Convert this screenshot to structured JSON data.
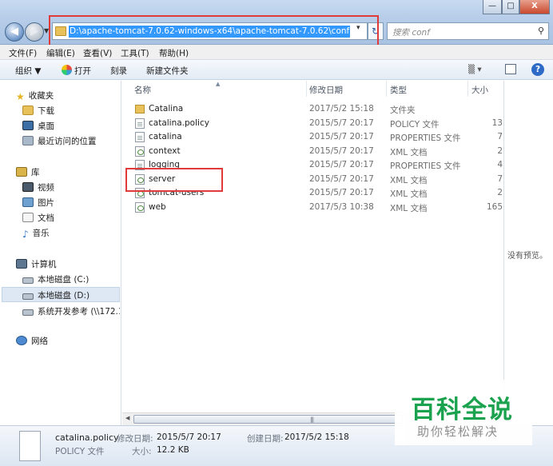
{
  "window": {
    "minimize": "—",
    "maximize": "□",
    "close": "X"
  },
  "address": {
    "path": "D:\\apache-tomcat-7.0.62-windows-x64\\apache-tomcat-7.0.62\\conf",
    "search_placeholder": "搜索 conf"
  },
  "menu": [
    "文件(F)",
    "编辑(E)",
    "查看(V)",
    "工具(T)",
    "帮助(H)"
  ],
  "toolbar": {
    "organize": "组织 ▼",
    "open": "打开",
    "burn": "刻录",
    "new_folder": "新建文件夹",
    "view_icon": "▒ ▾"
  },
  "nav": {
    "favorites": "收藏夹",
    "downloads": "下载",
    "desktop": "桌面",
    "recent": "最近访问的位置",
    "libraries": "库",
    "videos": "视频",
    "pictures": "图片",
    "documents": "文档",
    "music": "音乐",
    "computer": "计算机",
    "drive_c": "本地磁盘 (C:)",
    "drive_d": "本地磁盘 (D:)",
    "network_share": "系统开发参考 (\\\\172.1",
    "network": "网络"
  },
  "columns": {
    "name": "名称",
    "date": "修改日期",
    "type": "类型",
    "size": "大小"
  },
  "files": [
    {
      "name": "Catalina",
      "date": "2017/5/2 15:18",
      "type": "文件夹",
      "size": ""
    },
    {
      "name": "catalina.policy",
      "date": "2015/5/7 20:17",
      "type": "POLICY 文件",
      "size": "13"
    },
    {
      "name": "catalina",
      "date": "2015/5/7 20:17",
      "type": "PROPERTIES 文件",
      "size": "7"
    },
    {
      "name": "context",
      "date": "2015/5/7 20:17",
      "type": "XML 文档",
      "size": "2"
    },
    {
      "name": "logging",
      "date": "2015/5/7 20:17",
      "type": "PROPERTIES 文件",
      "size": "4"
    },
    {
      "name": "server",
      "date": "2015/5/7 20:17",
      "type": "XML 文档",
      "size": "7"
    },
    {
      "name": "tomcat-users",
      "date": "2015/5/7 20:17",
      "type": "XML 文档",
      "size": "2"
    },
    {
      "name": "web",
      "date": "2017/5/3 10:38",
      "type": "XML 文档",
      "size": "165"
    }
  ],
  "preview": {
    "text": "没有预览。"
  },
  "details": {
    "filename": "catalina.policy",
    "filetype": "POLICY 文件",
    "modified_label": "修改日期:",
    "modified_value": "2015/5/7 20:17",
    "created_label": "创建日期:",
    "created_value": "2017/5/2 15:18",
    "size_label": "大小:",
    "size_value": "12.2 KB"
  },
  "watermark": {
    "title": "百科全说",
    "subtitle": "助你轻松解决"
  },
  "colors": {
    "selection": "#3399ff",
    "highlight_box": "#e03a3a",
    "watermark_green": "#14a04a"
  }
}
